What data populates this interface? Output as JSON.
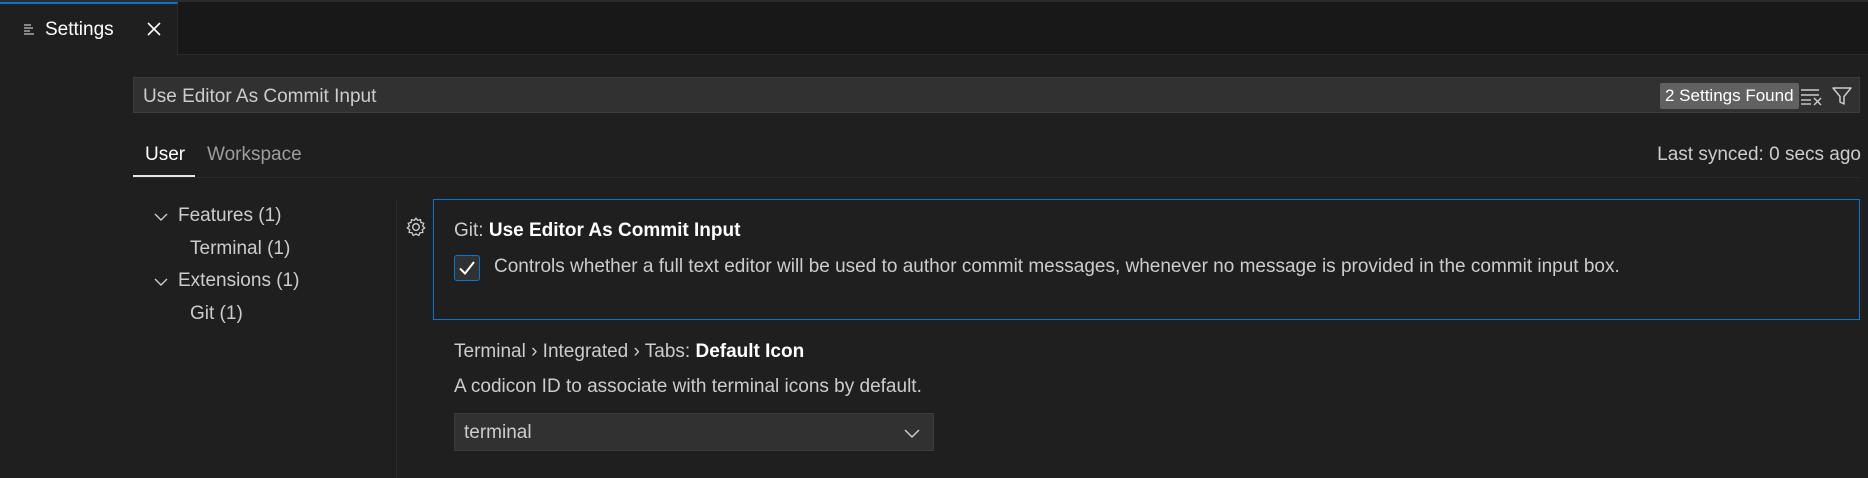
{
  "tab": {
    "label": "Settings",
    "icon": "settings-editor-icon"
  },
  "search": {
    "value": "Use Editor As Commit Input",
    "results_badge": "2 Settings Found"
  },
  "scope_tabs": [
    {
      "label": "User",
      "active": true
    },
    {
      "label": "Workspace",
      "active": false
    }
  ],
  "sync_status": "Last synced: 0 secs ago",
  "toc": [
    {
      "label": "Features (1)",
      "expanded": true,
      "level": 0
    },
    {
      "label": "Terminal (1)",
      "level": 1
    },
    {
      "label": "Extensions (1)",
      "expanded": true,
      "level": 0
    },
    {
      "label": "Git (1)",
      "level": 1
    }
  ],
  "settings": [
    {
      "category": "Git: ",
      "name": "Use Editor As Commit Input",
      "description": "Controls whether a full text editor will be used to author commit messages, whenever no message is provided in the commit input box.",
      "checked": true
    },
    {
      "category": "Terminal › Integrated › Tabs: ",
      "name": "Default Icon",
      "description": "A codicon ID to associate with terminal icons by default.",
      "value": "terminal"
    }
  ],
  "colors": {
    "accent": "#0078d4",
    "background": "#1f1f1f"
  }
}
